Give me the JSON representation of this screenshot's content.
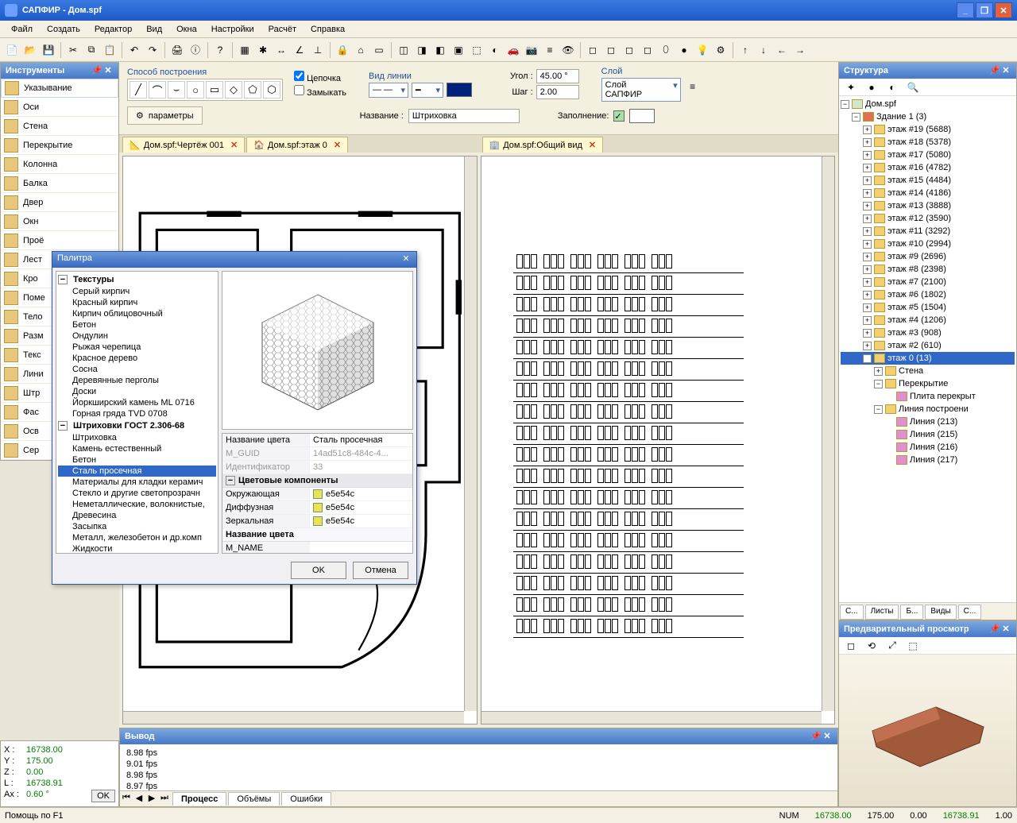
{
  "app": {
    "title": "САПФИР - Дом.spf"
  },
  "menu": [
    "Файл",
    "Создать",
    "Редактор",
    "Вид",
    "Окна",
    "Настройки",
    "Расчёт",
    "Справка"
  ],
  "tools_panel": {
    "title": "Инструменты",
    "items": [
      "Указывание",
      "Оси",
      "Стена",
      "Перекрытие",
      "Колонна",
      "Балка",
      "Двер",
      "Окн",
      "Проё",
      "Лест",
      "Кро",
      "Поме",
      "Тело",
      "Разм",
      "Текс",
      "Лини",
      "Штр",
      "Фас",
      "Осв",
      "Сер"
    ]
  },
  "coord": {
    "x_lbl": "X :",
    "x": "16738.00",
    "y_lbl": "Y :",
    "y": "175.00",
    "z_lbl": "Z :",
    "z": "0.00",
    "l_lbl": "L :",
    "l": "16738.91",
    "a_lbl": "Ax :",
    "a": "0.60 °",
    "ok": "OK"
  },
  "options": {
    "build_label": "Способ построения",
    "chain": "Цепочка",
    "close": "Замыкать",
    "lineview": "Вид линии",
    "params_btn": "параметры",
    "name_lbl": "Название :",
    "name_val": "Штриховка",
    "angle_lbl": "Угол :",
    "angle_val": "45.00 °",
    "step_lbl": "Шаг :",
    "step_val": "2.00",
    "layer_lbl": "Слой",
    "layer_val": "Слой САПФИР",
    "fill_lbl": "Заполнение:"
  },
  "doc_tabs": [
    {
      "label": "Дом.spf:Чертёж 001"
    },
    {
      "label": "Дом.spf:этаж 0"
    },
    {
      "label": "Дом.spf:Общий вид"
    }
  ],
  "palette": {
    "title": "Палитра",
    "cat1": "Текстуры",
    "tex_items": [
      "Серый кирпич",
      "Красный кирпич",
      "Кирпич облицовочный",
      "Бетон",
      "Ондулин",
      "Рыжая черепица",
      "Красное дерево",
      "Сосна",
      "Деревянные перголы",
      "Доски",
      "Йоркширский камень ML 0716",
      "Горная гряда TVD 0708"
    ],
    "cat2": "Штриховки ГОСТ 2.306-68",
    "hatch_items": [
      "Штриховка",
      "Камень естественный",
      "Бетон",
      "Сталь просечная",
      "Материалы для кладки керамич",
      "Стекло и другие светопрозрачн",
      "Неметаллические, волокнистые,",
      "Древесина",
      "Засыпка",
      "Металл, железобетон и др.комп",
      "Жидкости"
    ],
    "selected": "Сталь просечная",
    "prop_name": "Название цвета",
    "prop_name_v": "Сталь просечная",
    "prop_guid": "M_GUID",
    "prop_guid_v": "14ad51c8-484c-4...",
    "prop_id": "Идентификатор",
    "prop_id_v": "33",
    "comp_hdr": "Цветовые компоненты",
    "comp1": "Окружающая",
    "comp2": "Диффузная",
    "comp3": "Зеркальная",
    "comp_v": "e5e54c",
    "name_hdr": "Название цвета",
    "name_v": "M_NAME",
    "ok": "OK",
    "cancel": "Отмена"
  },
  "output": {
    "title": "Вывод",
    "lines": [
      "8.98 fps",
      "9.01 fps",
      "8.98 fps",
      "8.97 fps"
    ],
    "tabs": [
      "Процесс",
      "Объёмы",
      "Ошибки"
    ]
  },
  "structure": {
    "title": "Структура",
    "root": "Дом.spf",
    "building": "Здание 1 (3)",
    "floors": [
      "этаж #19 (5688)",
      "этаж #18 (5378)",
      "этаж #17 (5080)",
      "этаж #16 (4782)",
      "этаж #15 (4484)",
      "этаж #14 (4186)",
      "этаж #13 (3888)",
      "этаж #12 (3590)",
      "этаж #11 (3292)",
      "этаж #10 (2994)",
      "этаж #9 (2696)",
      "этаж #8 (2398)",
      "этаж #7 (2100)",
      "этаж #6 (1802)",
      "этаж #5 (1504)",
      "этаж #4 (1206)",
      "этаж #3 (908)",
      "этаж #2 (610)"
    ],
    "floor0": "этаж 0 (13)",
    "sub": [
      "Стена",
      "Перекрытие",
      "Плита перекрыт",
      "Линия построени",
      "Линия (213)",
      "Линия (215)",
      "Линия (216)",
      "Линия (217)"
    ],
    "tabs": [
      "С...",
      "Листы",
      "Б...",
      "Виды",
      "С..."
    ]
  },
  "preview": {
    "title": "Предварительный просмотр"
  },
  "status": {
    "help": "Помощь по F1",
    "num": "NUM",
    "c1": "16738.00",
    "c2": "175.00",
    "c3": "0.00",
    "c4": "16738.91",
    "c5": "1.00"
  }
}
